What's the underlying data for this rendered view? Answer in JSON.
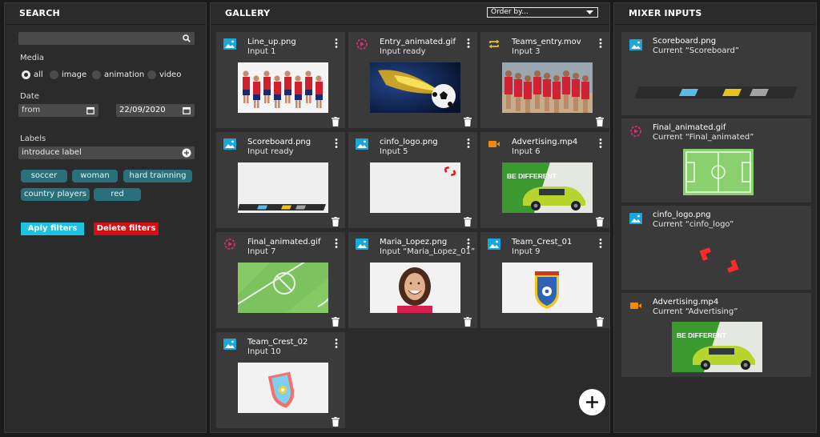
{
  "search": {
    "title": "SEARCH",
    "media_label": "Media",
    "media_options": [
      "all",
      "image",
      "animation",
      "video"
    ],
    "media_selected": "all",
    "date_label": "Date",
    "date_from_placeholder": "from",
    "date_to_value": "22/09/2020",
    "labels_label": "Labels",
    "labels_placeholder": "introduce label",
    "chips": [
      "soccer",
      "woman",
      "hard trainning",
      "country players",
      "red"
    ],
    "apply_label": "Aply filters",
    "delete_label": "Delete filters",
    "colors": {
      "apply": "#1fc1e0",
      "delete": "#d20f12",
      "chip": "#2a6f7c"
    }
  },
  "gallery": {
    "title": "GALLERY",
    "order_by": "Order by...",
    "items": [
      {
        "name": "Line_up.png",
        "status": "Input 1",
        "icon": "image-icon"
      },
      {
        "name": "Entry_animated.gif",
        "status": "Input ready",
        "icon": "animation-icon"
      },
      {
        "name": "Teams_entry.mov",
        "status": "Input 3",
        "icon": "loop-icon"
      },
      {
        "name": "Scoreboard.png",
        "status": "Input ready",
        "icon": "image-icon"
      },
      {
        "name": "cinfo_logo.png",
        "status": "Input 5",
        "icon": "image-icon"
      },
      {
        "name": "Advertising.mp4",
        "status": "Input 6",
        "icon": "video-icon"
      },
      {
        "name": "Final_animated.gif",
        "status": "Input 7",
        "icon": "animation-icon"
      },
      {
        "name": "Maria_Lopez.png",
        "status": "Input “Maria_Lopez_01”",
        "icon": "image-icon"
      },
      {
        "name": "Team_Crest_01",
        "status": "Input 9",
        "icon": "image-icon"
      },
      {
        "name": "Team_Crest_02",
        "status": "Input 10",
        "icon": "image-icon"
      }
    ],
    "add_icon": "plus-icon"
  },
  "mixer": {
    "title": "MIXER INPUTS",
    "items": [
      {
        "name": "Scoreboard.png",
        "current": "Current “Scoreboard”",
        "icon": "image-icon"
      },
      {
        "name": "Final_animated.gif",
        "current": "Current “Final_animated”",
        "icon": "animation-icon"
      },
      {
        "name": "cinfo_logo.png",
        "current": "Current “cinfo_logo”",
        "icon": "image-icon"
      },
      {
        "name": "Advertising.mp4",
        "current": "Current “Advertising”",
        "icon": "video-icon"
      }
    ]
  },
  "ad_text": "BE DIFFERENT"
}
